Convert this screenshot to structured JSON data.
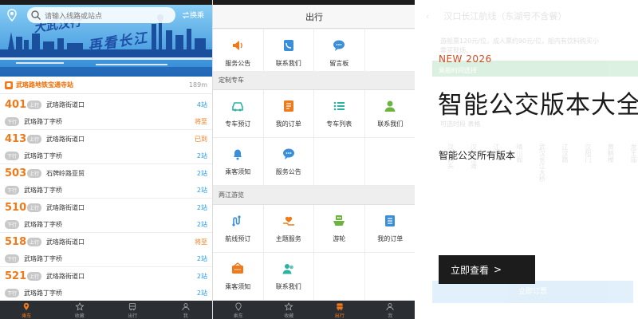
{
  "panel1": {
    "search": {
      "placeholder": "请输入线路或站点"
    },
    "change_label": "换乘",
    "banner": {
      "slogan_top": "大武汉行",
      "slogan": "再看长江"
    },
    "station": {
      "name": "武珞路地铁宝通寺站",
      "distance": "189m"
    },
    "routes": [
      {
        "number": "401",
        "rows": [
          {
            "dir": "上行",
            "dest": "武珞路街道口",
            "status": "4站",
            "warn": false
          },
          {
            "dir": "下行",
            "dest": "武珞路丁字桥",
            "status": "将至",
            "warn": true
          }
        ]
      },
      {
        "number": "413",
        "rows": [
          {
            "dir": "上行",
            "dest": "武珞路街道口",
            "status": "已到",
            "warn": true
          },
          {
            "dir": "下行",
            "dest": "武珞路丁字桥",
            "status": "2站",
            "warn": false
          }
        ]
      },
      {
        "number": "503",
        "rows": [
          {
            "dir": "上行",
            "dest": "石牌岭路亚贸",
            "status": "2站",
            "warn": false
          },
          {
            "dir": "下行",
            "dest": "武珞路丁字桥",
            "status": "2站",
            "warn": false
          }
        ]
      },
      {
        "number": "510",
        "rows": [
          {
            "dir": "上行",
            "dest": "武珞路街道口",
            "status": "2站",
            "warn": false
          },
          {
            "dir": "下行",
            "dest": "武珞路丁字桥",
            "status": "2站",
            "warn": false
          }
        ]
      },
      {
        "number": "518",
        "rows": [
          {
            "dir": "上行",
            "dest": "武珞路街道口",
            "status": "将至",
            "warn": true
          },
          {
            "dir": "下行",
            "dest": "武珞路丁字桥",
            "status": "2站",
            "warn": false
          }
        ]
      },
      {
        "number": "521",
        "rows": [
          {
            "dir": "上行",
            "dest": "武珞路街道口",
            "status": "2站",
            "warn": false
          },
          {
            "dir": "下行",
            "dest": "武珞路丁字桥",
            "status": "2站",
            "warn": false
          }
        ]
      }
    ],
    "tabs": [
      "乘车",
      "收藏",
      "出行",
      "我"
    ]
  },
  "panel2": {
    "title": "出行",
    "row1": [
      {
        "label": "服务公告",
        "icon": "megaphone-icon",
        "color": "#f07a1a"
      },
      {
        "label": "联系我们",
        "icon": "phone-icon",
        "color": "#3a8fd8"
      },
      {
        "label": "留言板",
        "icon": "chat-icon",
        "color": "#3a8fd8"
      }
    ],
    "section1": "定制专车",
    "row2": [
      {
        "label": "专车预订",
        "icon": "car-icon",
        "color": "#2bb3a0"
      },
      {
        "label": "我的订单",
        "icon": "order-icon",
        "color": "#f07a1a"
      },
      {
        "label": "专车列表",
        "icon": "list-icon",
        "color": "#2bb3a0"
      },
      {
        "label": "联系我们",
        "icon": "person-icon",
        "color": "#6cb33f"
      }
    ],
    "row3": [
      {
        "label": "乘客须知",
        "icon": "bell-icon",
        "color": "#3a8fd8"
      },
      {
        "label": "服务公告",
        "icon": "chat-icon",
        "color": "#3a8fd8"
      }
    ],
    "section2": "两江游览",
    "row4": [
      {
        "label": "航线预订",
        "icon": "route-icon",
        "color": "#3a8fd8"
      },
      {
        "label": "主题服务",
        "icon": "heart-hand-icon",
        "color": "#f07a1a"
      },
      {
        "label": "游轮",
        "icon": "ship-icon",
        "color": "#6cb33f"
      },
      {
        "label": "我的订单",
        "icon": "order-list-icon",
        "color": "#3a8fd8"
      }
    ],
    "row5": [
      {
        "label": "乘客须知",
        "icon": "ticket-icon",
        "color": "#f07a1a"
      },
      {
        "label": "联系我们",
        "icon": "people-icon",
        "color": "#2bb3a0"
      }
    ],
    "tabs": [
      "乘车",
      "收藏",
      "出行",
      "我"
    ]
  },
  "panel3": {
    "ghost": {
      "title": "汉口长江航线（东湖号不含餐）",
      "line1": "游船票120元/位，成人票约90元/位，船内有饮料购买小",
      "line2": "零买现场。",
      "bar": "乘船时间选择",
      "line3": "可选时段 表格",
      "cols": [
        "汉口码头",
        "汉口江滩",
        "江滩",
        "晴川阁",
        "武汉长江大桥",
        "江汉路",
        "汉阳门",
        "黄鹤楼",
        "龙王庙"
      ],
      "button": "立即订票"
    },
    "eyebrow": "NEW 2026",
    "headline": "智能公交版本大全",
    "sub": "智能公交所有版本",
    "cta": {
      "label": "立即查看",
      "arrow": ">"
    }
  },
  "colors": {
    "accent": "#f07a1a",
    "blue": "#2b9be3",
    "tabbar": "#2b2f33",
    "cta": "#1c1c1c",
    "eyebrow": "#d64a1e"
  }
}
